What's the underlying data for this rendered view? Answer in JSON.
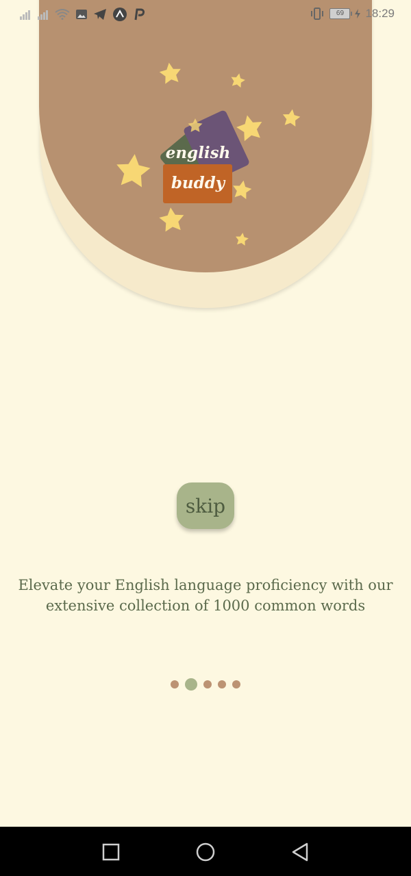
{
  "status_bar": {
    "time": "18:29",
    "battery": "69",
    "left_icons": [
      "signal-icon",
      "signal-icon",
      "wifi-icon",
      "image-icon",
      "telegram-icon",
      "arc-icon",
      "p-app-icon"
    ],
    "right_icons": [
      "vibrate-icon",
      "battery-icon",
      "charging-icon"
    ]
  },
  "hero": {
    "logo_line1": "english",
    "logo_line2": "buddy",
    "colors": {
      "background": "#b79170",
      "star": "#f7d774",
      "card_green": "#5b6a4c",
      "card_purple": "#6b5476",
      "card_orange": "#c06426"
    }
  },
  "skip_label": "skip",
  "description": "Elevate your English language proficiency with our extensive collection of 1000 common words",
  "pager": {
    "total": 5,
    "active_index": 1
  },
  "nav_bar": {
    "buttons": [
      "recents-button",
      "home-button",
      "back-button"
    ]
  },
  "theme": {
    "page_bg": "#fdf8e1",
    "accent_green": "#a8b48a",
    "text_green": "#5b6a4c",
    "dot_brown": "#bc9373"
  }
}
